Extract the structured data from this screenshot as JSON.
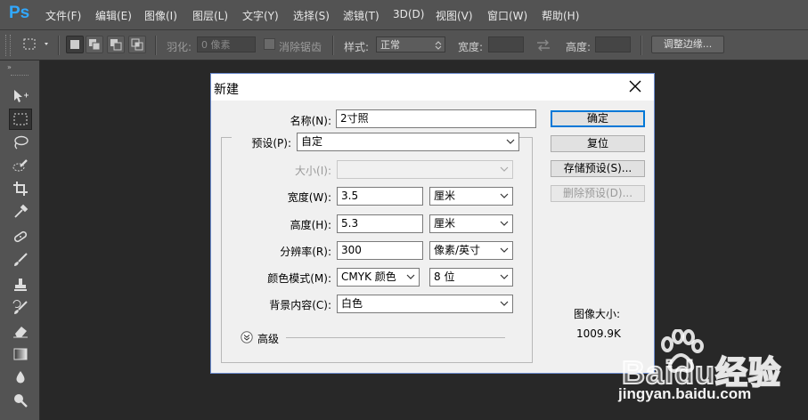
{
  "app": {
    "logo": "Ps"
  },
  "menu": [
    "文件(F)",
    "编辑(E)",
    "图像(I)",
    "图层(L)",
    "文字(Y)",
    "选择(S)",
    "滤镜(T)",
    "3D(D)",
    "视图(V)",
    "窗口(W)",
    "帮助(H)"
  ],
  "options": {
    "feather_label": "羽化:",
    "feather_value": "0 像素",
    "antialias_label": "消除锯齿",
    "style_label": "样式:",
    "style_value": "正常",
    "width_label": "宽度:",
    "height_label": "高度:",
    "refine_edge_button": "调整边缘..."
  },
  "dialog": {
    "title": "新建",
    "name_label": "名称(N):",
    "name_value": "2寸照",
    "preset_label": "预设(P):",
    "preset_value": "自定",
    "size_label": "大小(I):",
    "size_value": "",
    "width_label": "宽度(W):",
    "width_value": "3.5",
    "width_unit": "厘米",
    "height_label": "高度(H):",
    "height_value": "5.3",
    "height_unit": "厘米",
    "resolution_label": "分辨率(R):",
    "resolution_value": "300",
    "resolution_unit": "像素/英寸",
    "colormode_label": "颜色模式(M):",
    "colormode_value": "CMYK 颜色",
    "bitdepth_value": "8 位",
    "background_label": "背景内容(C):",
    "background_value": "白色",
    "advanced_label": "高级",
    "buttons": {
      "ok": "确定",
      "reset": "复位",
      "save_preset": "存储预设(S)...",
      "delete_preset": "删除预设(D)..."
    },
    "image_size_label": "图像大小:",
    "image_size_value": "1009.9K"
  },
  "watermark": {
    "brand": "Baidu经验",
    "url": "jingyan.baidu.com"
  },
  "colors": {
    "ps_blue": "#31a8ff",
    "ui_gray": "#535353",
    "canvas": "#282828",
    "dialog_bg": "#f0f0f0"
  }
}
